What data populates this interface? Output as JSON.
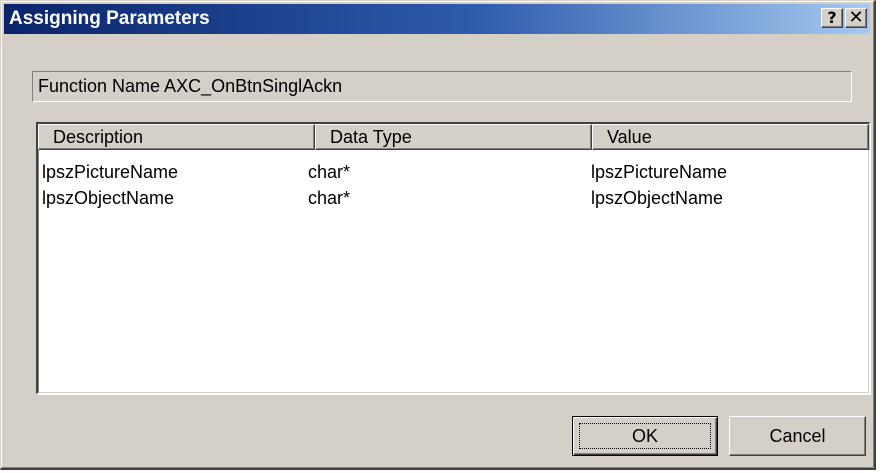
{
  "window": {
    "title": "Assigning Parameters",
    "help_glyph": "?",
    "close_glyph": "✕"
  },
  "function_name": "Function Name AXC_OnBtnSinglAckn",
  "table": {
    "columns": [
      "Description",
      "Data Type",
      "Value"
    ],
    "rows": [
      [
        "lpszPictureName",
        "char*",
        "lpszPictureName"
      ],
      [
        "lpszObjectName",
        "char*",
        "lpszObjectName"
      ]
    ]
  },
  "buttons": {
    "ok_label": "OK",
    "cancel_label": "Cancel"
  },
  "colors": {
    "title_gradient_start": "#0a246a",
    "title_gradient_end": "#a6caf0",
    "face": "#d4d0c8"
  }
}
